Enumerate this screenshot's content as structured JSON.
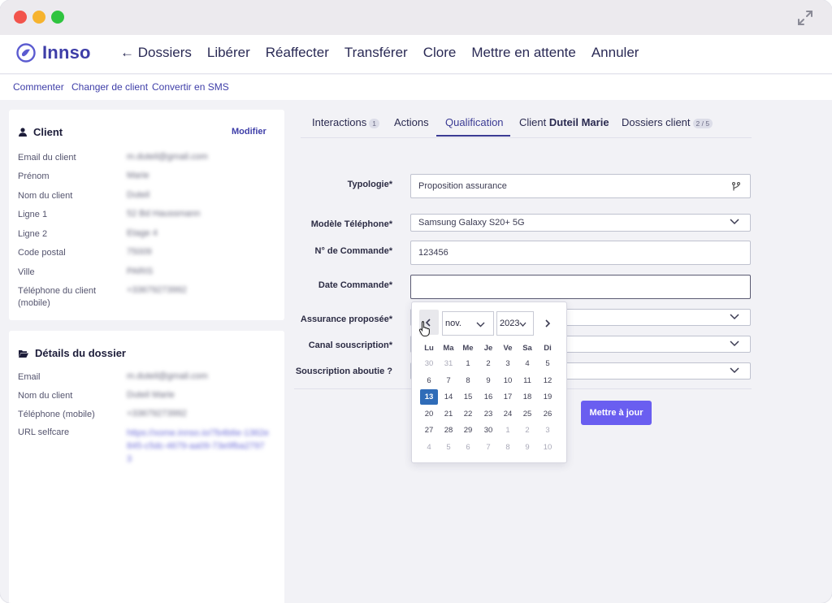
{
  "app": {
    "name": "Innso"
  },
  "nav": {
    "back_arrow": "←",
    "items": [
      "Dossiers",
      "Libérer",
      "Réaffecter",
      "Transférer",
      "Clore",
      "Mettre en attente",
      "Annuler"
    ]
  },
  "subbar": {
    "links": [
      "Commenter",
      "Changer de client",
      "Convertir en SMS"
    ]
  },
  "client_card": {
    "title": "Client",
    "action": "Modifier",
    "rows": [
      {
        "label": "Email du client",
        "value": "m.duteil@gmail.com"
      },
      {
        "label": "Prénom",
        "value": "Marie"
      },
      {
        "label": "Nom du client",
        "value": "Duteil"
      },
      {
        "label": "Ligne 1",
        "value": "52 Bd Haussmann"
      },
      {
        "label": "Ligne 2",
        "value": "Etage 4"
      },
      {
        "label": "Code postal",
        "value": "75009"
      },
      {
        "label": "Ville",
        "value": "PARIS"
      },
      {
        "label": "Téléphone du client (mobile)",
        "value": "+33679273992"
      }
    ]
  },
  "dossier_card": {
    "title": "Détails du dossier",
    "rows": [
      {
        "label": "Email",
        "value": "m.duteil@gmail.com"
      },
      {
        "label": "Nom du client",
        "value": "Duteil Marie"
      },
      {
        "label": "Téléphone (mobile)",
        "value": "+33679273992"
      },
      {
        "label": "URL selfcare",
        "value": "https://xome.innso.io/7b4b6e-1362e845-c5dc-4679-aa09-73e9fba27973"
      }
    ]
  },
  "tabs": [
    {
      "label": "Interactions",
      "badge": "1"
    },
    {
      "label": "Actions"
    },
    {
      "label": "Qualification",
      "active": true
    },
    {
      "label": "Client",
      "bold": "Duteil Marie"
    },
    {
      "label": "Dossiers client",
      "badge": "2 / 5"
    }
  ],
  "form": {
    "fields": [
      {
        "label": "Typologie*",
        "value": "Proposition assurance"
      },
      {
        "label": "Modèle Téléphone*",
        "value": "Samsung Galaxy S20+ 5G"
      },
      {
        "label": "N° de Commande*",
        "value": "123456"
      },
      {
        "label": "Date Commande*",
        "value": ""
      },
      {
        "label": "Assurance proposée*",
        "value": ""
      },
      {
        "label": "Canal souscription*",
        "value": ""
      },
      {
        "label": "Souscription aboutie ?",
        "value": ""
      }
    ],
    "submit_label": "Mettre à jour"
  },
  "datepicker": {
    "month": "nov.",
    "year": "2023",
    "weekdays": [
      "Lu",
      "Ma",
      "Me",
      "Je",
      "Ve",
      "Sa",
      "Di"
    ],
    "weeks": [
      [
        "30",
        "31",
        "1",
        "2",
        "3",
        "4",
        "5"
      ],
      [
        "6",
        "7",
        "8",
        "9",
        "10",
        "11",
        "12"
      ],
      [
        "13",
        "14",
        "15",
        "16",
        "17",
        "18",
        "19"
      ],
      [
        "20",
        "21",
        "22",
        "23",
        "24",
        "25",
        "26"
      ],
      [
        "27",
        "28",
        "29",
        "30",
        "1",
        "2",
        "3"
      ],
      [
        "4",
        "5",
        "6",
        "7",
        "8",
        "9",
        "10"
      ]
    ],
    "selected": "13"
  },
  "colors": {
    "brand": "#3e3ea8",
    "accent": "#6a5ef0",
    "selected_day": "#2f6cb8"
  }
}
